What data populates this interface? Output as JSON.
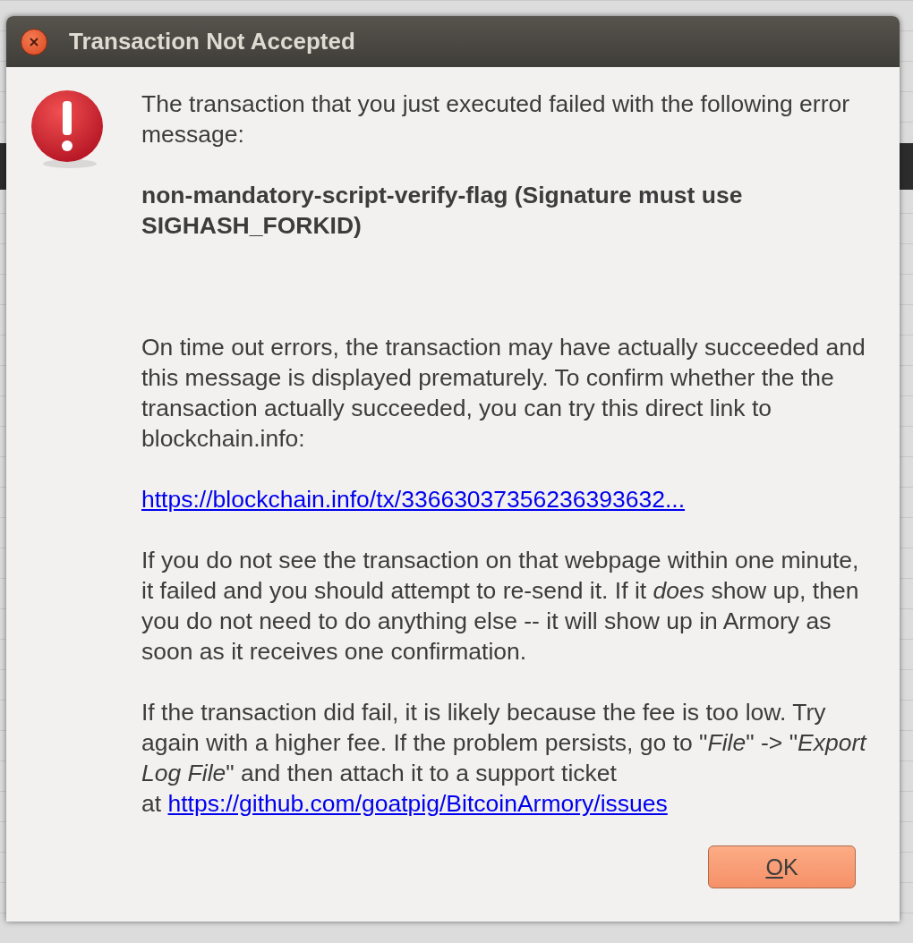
{
  "dialog": {
    "title": "Transaction Not Accepted",
    "message": "The transaction that you just executed failed with the following error message:",
    "error": "non-mandatory-script-verify-flag (Signature must use SIGHASH_FORKID)",
    "paragraphs": [
      {
        "text": "On time out errors, the transaction may have actually succeeded and this message is displayed prematurely. To confirm whether the the transaction actually succeeded, you can try this direct link to blockchain.info:"
      },
      {
        "link": "https://blockchain.info/tx/33663037356236393632..."
      },
      {
        "text": "If you do not see the transaction on that webpage within one minute, it failed and you should attempt to re-send it. If it *does* show up, then you do not need to do anything else -- it will show up in Armory as soon as it receives one confirmation."
      },
      {
        "text": "If the transaction did fail, it is likely because the fee is too low. Try again with a higher fee. If the problem persists, go to \"*File*\" -> \"*Export Log File*\" and then attach it to a support ticket at",
        "link": "https://github.com/goatpig/BitcoinArmory/issues"
      }
    ],
    "buttons": [
      {
        "label": "OK"
      }
    ]
  }
}
